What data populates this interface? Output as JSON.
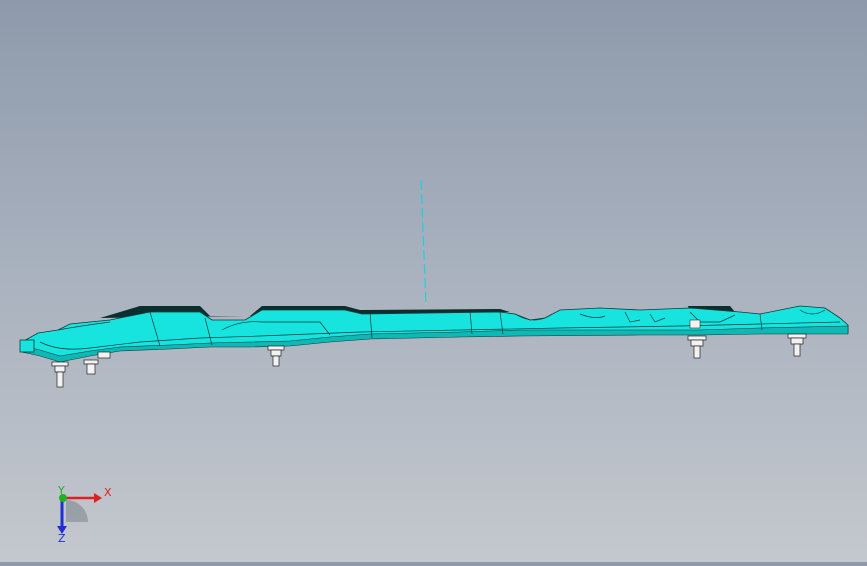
{
  "viewport": {
    "background_top": "#8e9aab",
    "background_bottom": "#c4c8ce",
    "part_color": "#17e3df",
    "part_edge_color": "#0b3b3a",
    "centerline_color": "#1fd0e0",
    "fastener_color": "#f2f2f2"
  },
  "triad": {
    "x_label": "X",
    "y_label": "Y",
    "z_label": "Z",
    "x_color": "#e02020",
    "y_color": "#20b020",
    "z_color": "#2030d0"
  }
}
